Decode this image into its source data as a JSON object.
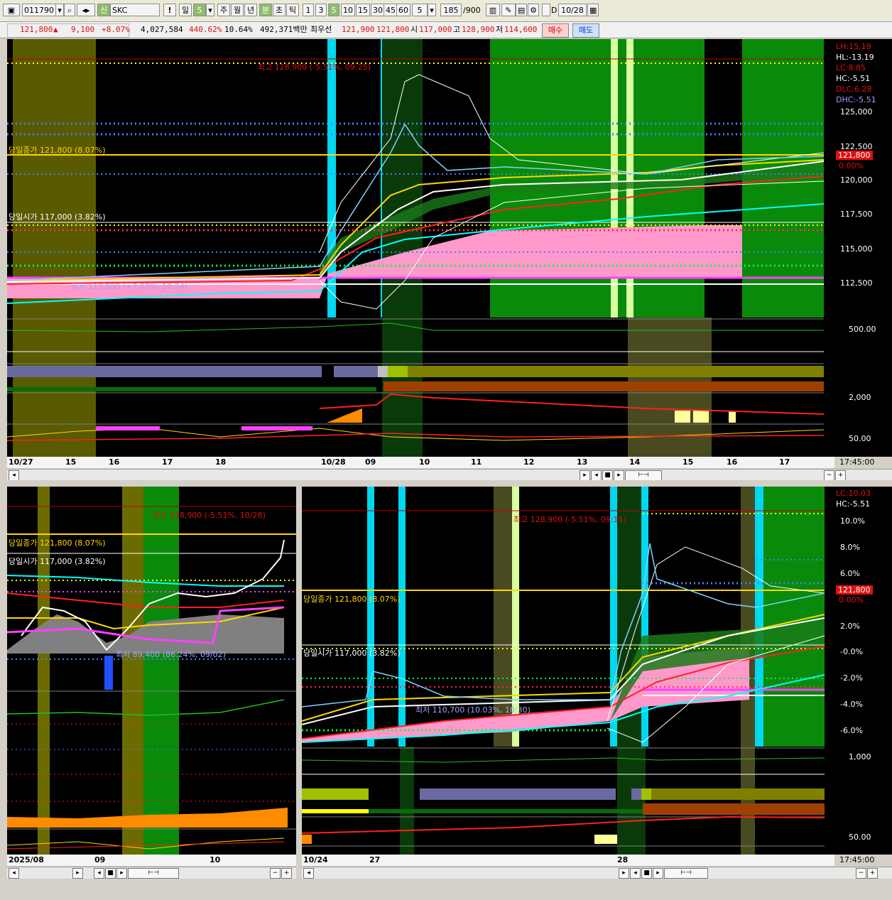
{
  "toolbar": {
    "code": "011790",
    "market_badge": "신",
    "name": "SKC",
    "alert": "!",
    "periods": [
      "일",
      "주",
      "월",
      "년",
      "분",
      "초",
      "틱"
    ],
    "selected_period": "분",
    "day_value": "5",
    "minute_buttons": [
      "1",
      "3",
      "5",
      "10",
      "15",
      "30",
      "45",
      "60"
    ],
    "selected_minute": "5",
    "unit_value": "5",
    "count": "185",
    "count_total": "/900",
    "date": "10/28",
    "date_flag": "D"
  },
  "quote": {
    "price": "121,800",
    "change_arrow": "▲",
    "change": "9,100",
    "change_pct": "+8.07%",
    "volume": "4,027,584",
    "vol_ratio": "440.62%",
    "turnover": "10.64%",
    "amount": "492,371백만",
    "best_label": "최우선",
    "ask": "121,900",
    "bid": "121,800",
    "open_label": "시",
    "open": "117,000",
    "high_label": "고",
    "high": "128,900",
    "low_label": "저",
    "low": "114,600",
    "buy_button": "매수",
    "sell_button": "매도"
  },
  "colors": {
    "up": "#e01010",
    "down": "#2060ff",
    "close_line": "#ffd700",
    "pink_band": "#ff99cc",
    "green_zone": "#0a8a0a",
    "olive_zone": "#6b6b00",
    "cyan_bar": "#00e5ff"
  },
  "top_chart": {
    "high_annotation": "최고 128,900 (-5.51%, 09:25)",
    "close_label": "당일종가 121,800 (8.07%)",
    "open_label": "당일시가 117,000 (3.82%)",
    "low_annotation": "최저 113,800 (+7.03%, 10:24)",
    "stats": [
      "LH:15.19",
      "HL:-13.19",
      "LC:8.85",
      "HC:-5.51",
      "DLC:6.28",
      "DHC:-5.51"
    ],
    "price_tag": "121,800",
    "pct_tag": "0.00%",
    "y_ticks": [
      "125,000",
      "122,500",
      "120,000",
      "117,500",
      "115,000",
      "112,500"
    ],
    "sub_labels": [
      "500.00",
      "2,000",
      "50.00"
    ],
    "x_ticks": [
      "10/27",
      "15",
      "16",
      "17",
      "18",
      "10/28",
      "09",
      "10",
      "11",
      "12",
      "13",
      "14",
      "15",
      "16",
      "17"
    ],
    "time": "17:45:00"
  },
  "left_chart": {
    "high_annotation": "최고 128,900 (-5.51%, 10/28)",
    "close_label": "당일종가 121,800 (8.07%)",
    "open_label": "당일시가 117,000 (3.82%)",
    "low_annotation": "최저 89,400 (86.24%, 09/02)",
    "x_ticks": [
      "2025/08",
      "09",
      "10"
    ]
  },
  "right_chart": {
    "high_annotation": "최고 128,900 (-5.51%, 09:15)",
    "close_label": "당일종가 121,800 (8.07%)",
    "open_label": "당일시가 117,000 (3.82%)",
    "low_annotation": "최저 110,700 (10.03%, 10:30)",
    "stats": [
      "LC:10.03",
      "HC:-5.51"
    ],
    "price_tag": "121,800",
    "pct_tag": "0.00%",
    "y_ticks": [
      "10.0%",
      "8.0%",
      "6.0%",
      "4.0%",
      "2.0%",
      "0.0%",
      "-0.0%",
      "-2.0%",
      "-4.0%",
      "-6.0%"
    ],
    "sub_labels": [
      "1,000",
      "50.00"
    ],
    "x_ticks": [
      "10/24",
      "27",
      "28"
    ],
    "time": "17:45:00"
  }
}
